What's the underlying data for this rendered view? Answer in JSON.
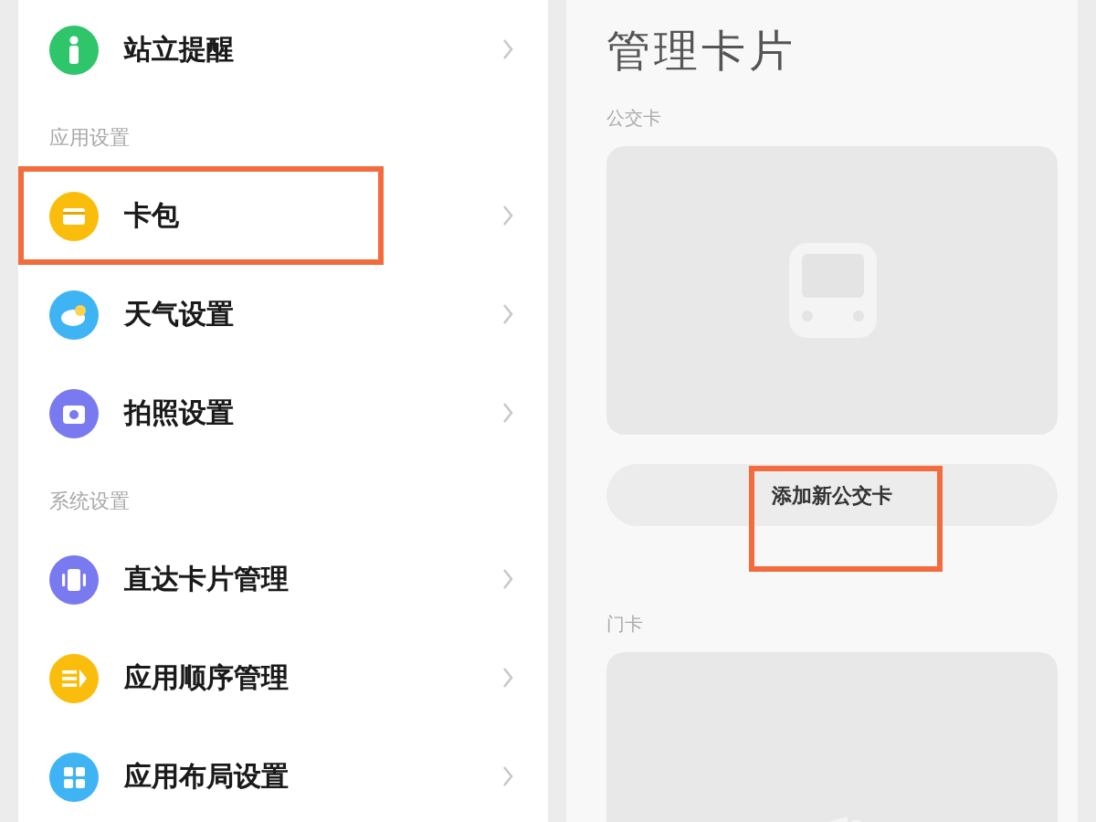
{
  "settings": [
    {
      "kind": "item",
      "label": "站立提醒",
      "color": "#2fc56a",
      "highlighted": false
    },
    {
      "kind": "header",
      "label": "应用设置"
    },
    {
      "kind": "item",
      "label": "卡包",
      "color": "#fbbd0b",
      "highlighted": true
    },
    {
      "kind": "item",
      "label": "天气设置",
      "color": "#3fb4f5",
      "highlighted": false
    },
    {
      "kind": "item",
      "label": "拍照设置",
      "color": "#7a7af0",
      "highlighted": false
    },
    {
      "kind": "header",
      "label": "系统设置"
    },
    {
      "kind": "item",
      "label": "直达卡片管理",
      "color": "#7a7af0",
      "highlighted": false
    },
    {
      "kind": "item",
      "label": "应用顺序管理",
      "color": "#fbbd0b",
      "highlighted": false
    },
    {
      "kind": "item",
      "label": "应用布局设置",
      "color": "#3fb4f5",
      "highlighted": false
    }
  ],
  "manage": {
    "title": "管理卡片",
    "sections": [
      {
        "kind": "bus",
        "label": "公交卡",
        "button": "添加新公交卡",
        "highlighted": true
      },
      {
        "kind": "door",
        "label": "门卡"
      }
    ]
  }
}
